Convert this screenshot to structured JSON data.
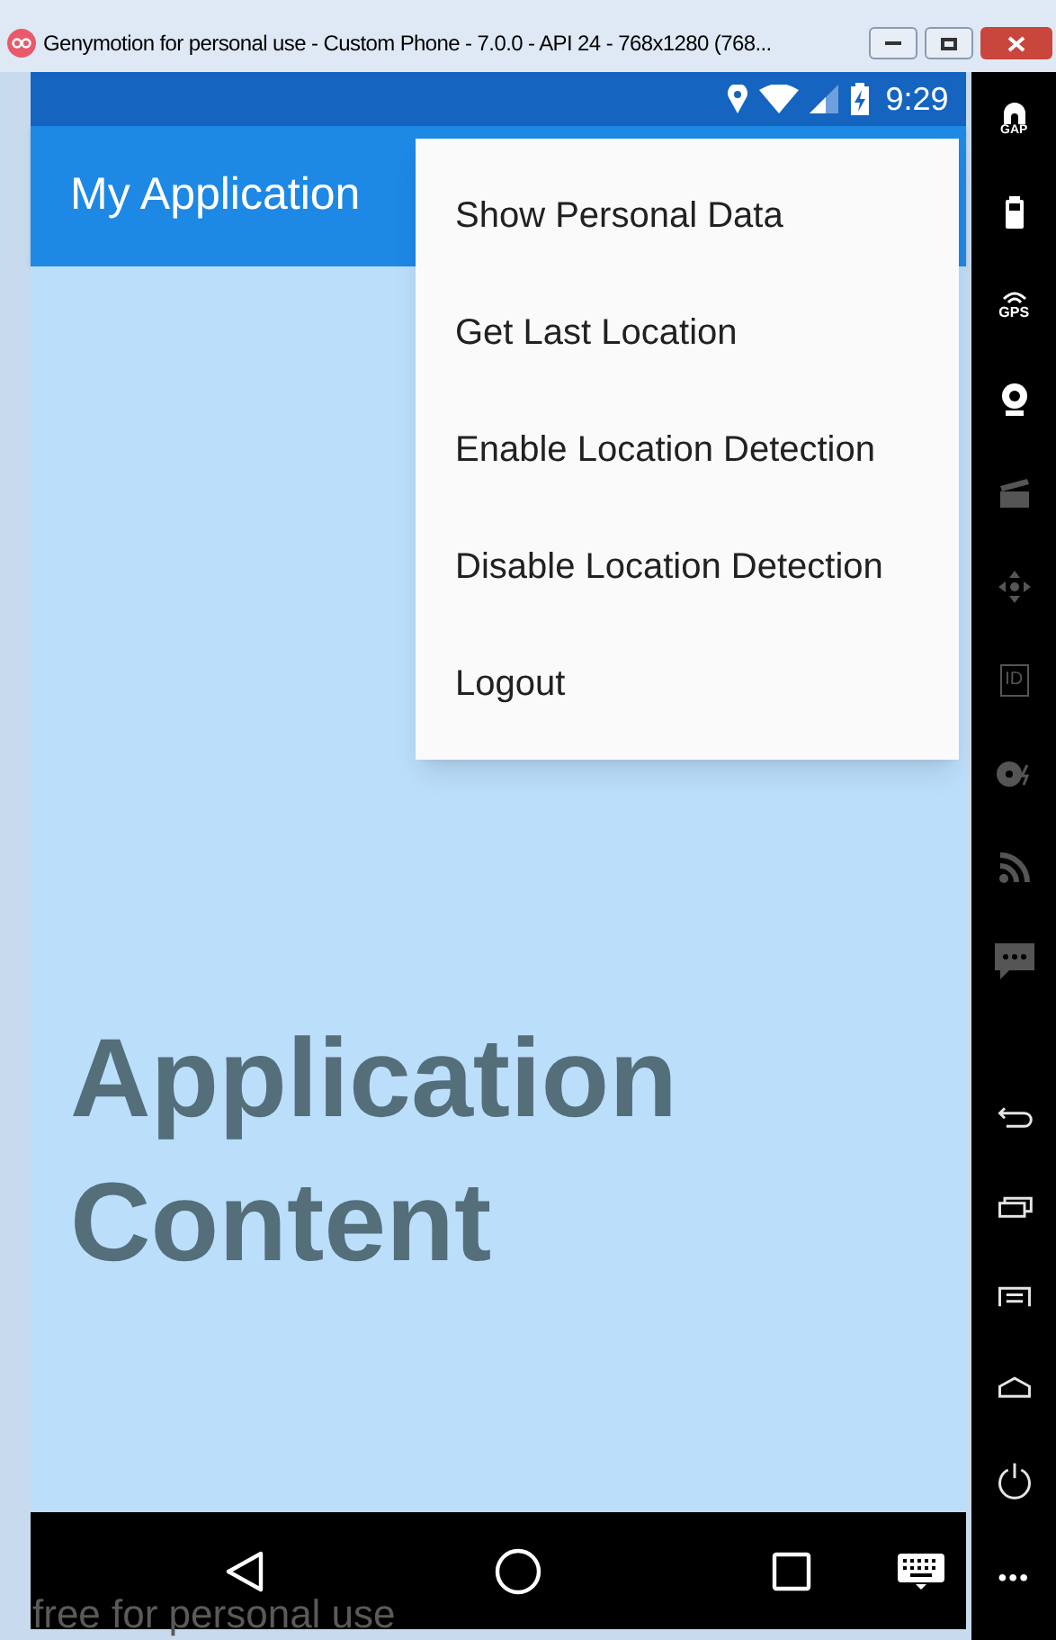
{
  "window": {
    "title": "Genymotion for personal use - Custom Phone - 7.0.0 - API 24 - 768x1280 (768..."
  },
  "status_bar": {
    "time": "9:29"
  },
  "app_bar": {
    "title": "My Application"
  },
  "menu": {
    "items": [
      {
        "label": "Show Personal Data"
      },
      {
        "label": "Get Last Location"
      },
      {
        "label": "Enable Location Detection"
      },
      {
        "label": "Disable Location Detection"
      },
      {
        "label": "Logout"
      }
    ]
  },
  "content": {
    "text": "Application Content"
  },
  "overlay_text": "free for personal use",
  "sidebar": {
    "items": [
      {
        "kind": "gapps",
        "label": "GAP",
        "disabled": false
      },
      {
        "kind": "battery",
        "disabled": false
      },
      {
        "kind": "gps",
        "label": "GPS",
        "disabled": false
      },
      {
        "kind": "webcam",
        "disabled": false
      },
      {
        "kind": "clapper",
        "disabled": true
      },
      {
        "kind": "dpad",
        "disabled": true
      },
      {
        "kind": "id",
        "label": "ID",
        "disabled": true
      },
      {
        "kind": "disk",
        "disabled": true
      },
      {
        "kind": "rss",
        "disabled": true
      },
      {
        "kind": "chat",
        "disabled": true
      }
    ],
    "controls": [
      {
        "kind": "back"
      },
      {
        "kind": "recent"
      },
      {
        "kind": "menu"
      },
      {
        "kind": "home"
      },
      {
        "kind": "power"
      }
    ],
    "more": "•••"
  }
}
